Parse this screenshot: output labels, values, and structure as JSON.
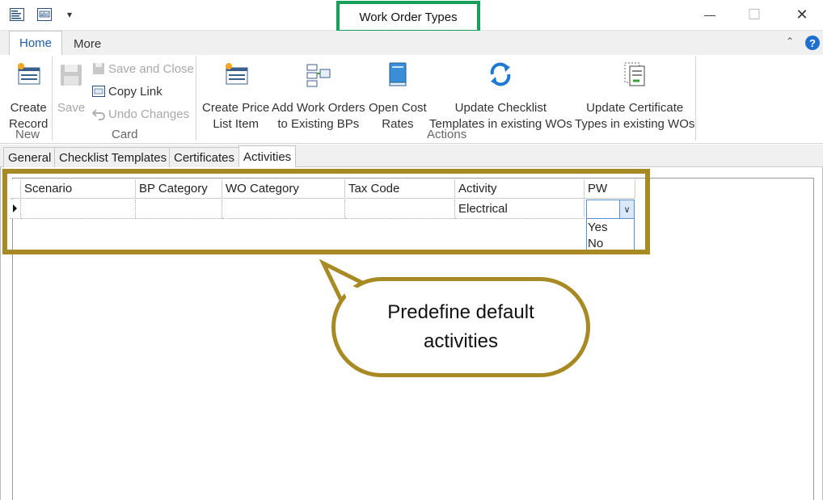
{
  "window": {
    "title": "Work Order Types",
    "minimize_glyph": "—",
    "maximize_glyph": "☐",
    "close_glyph": "✕",
    "qat_dropdown_glyph": "▾"
  },
  "ribbon_tabs": [
    {
      "label": "Home",
      "active": true
    },
    {
      "label": "More",
      "active": false
    }
  ],
  "ribbon": {
    "collapse_glyph": "⌃",
    "help_glyph": "?",
    "groups": {
      "new": {
        "label": "New",
        "create_record_line1": "Create",
        "create_record_line2": "Record"
      },
      "card": {
        "label": "Card",
        "save": "Save",
        "save_and_close": "Save and Close",
        "copy_link": "Copy Link",
        "undo_changes": "Undo Changes"
      },
      "actions": {
        "label": "Actions",
        "create_price_list_item_line1": "Create Price",
        "create_price_list_item_line2": "List Item",
        "add_work_orders_line1": "Add Work Orders",
        "add_work_orders_line2": "to Existing BPs",
        "open_cost_rates_line1": "Open Cost",
        "open_cost_rates_line2": "Rates",
        "update_checklist_line1": "Update Checklist",
        "update_checklist_line2": "Templates in existing WOs",
        "update_certificate_line1": "Update Certificate",
        "update_certificate_line2": "Types in existing WOs"
      }
    }
  },
  "inner_tabs": [
    {
      "label": "General",
      "active": false
    },
    {
      "label": "Checklist Templates",
      "active": false
    },
    {
      "label": "Certificates",
      "active": false
    },
    {
      "label": "Activities",
      "active": true
    }
  ],
  "grid": {
    "columns": [
      "Scenario",
      "BP Category",
      "WO Category",
      "Tax Code",
      "Activity",
      "PW"
    ],
    "rows": [
      {
        "scenario": "",
        "bp_category": "",
        "wo_category": "",
        "tax_code": "",
        "activity": "Electrical",
        "pw": ""
      }
    ],
    "pw_options": [
      "Yes",
      "No"
    ],
    "dropdown_arrow_glyph": "∨"
  },
  "callout": {
    "line1": "Predefine default",
    "line2": "activities"
  },
  "colors": {
    "title_highlight": "#17a05a",
    "annotation": "#a88a25",
    "accent": "#1f5fa8"
  }
}
